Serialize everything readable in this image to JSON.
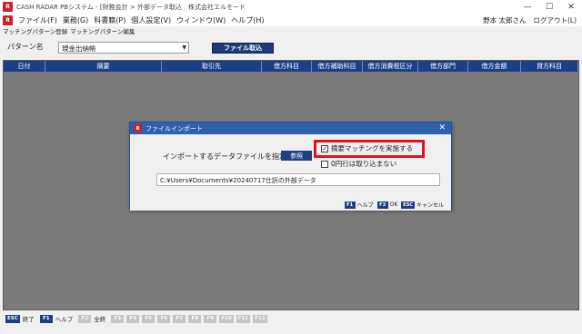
{
  "window": {
    "title": "CASH RADAR PBシステム - [財務会計 > 外部データ取込　株式会社エルモード",
    "icon_label": "R",
    "controls": [
      "—",
      "☐",
      "✕"
    ]
  },
  "menu": {
    "items": [
      "ファイル(F)",
      "業務(G)",
      "科書籍(P)",
      "個人設定(V)",
      "ウィンドウ(W)",
      "ヘルプ(H)"
    ],
    "user": "野本 太郎さん",
    "logout": "ログアウト(L)"
  },
  "subtabs": [
    "マッチングパターン登録",
    "マッチングパターン編集"
  ],
  "pattern": {
    "label": "パターン名",
    "value": "現金出納帳",
    "file_button": "ファイル取込"
  },
  "grid": {
    "columns": [
      "日付",
      "摘要",
      "取引先",
      "借方科目",
      "借方補助科目",
      "借方消費税区分",
      "借方部門",
      "借方金額",
      "貸方科目"
    ]
  },
  "status": {
    "keys": [
      {
        "key": "ESC",
        "label": "終了",
        "enabled": true
      },
      {
        "key": "F1",
        "label": "ヘルプ",
        "enabled": true
      },
      {
        "key": "F2",
        "label": "全終",
        "enabled": false
      },
      {
        "key": "F3",
        "label": "",
        "enabled": false
      },
      {
        "key": "F4",
        "label": "",
        "enabled": false
      },
      {
        "key": "F5",
        "label": "",
        "enabled": false
      },
      {
        "key": "F6",
        "label": "",
        "enabled": false
      },
      {
        "key": "F7",
        "label": "",
        "enabled": false
      },
      {
        "key": "F8",
        "label": "",
        "enabled": false
      },
      {
        "key": "F9",
        "label": "",
        "enabled": false
      },
      {
        "key": "F10",
        "label": "",
        "enabled": false
      },
      {
        "key": "F11",
        "label": "",
        "enabled": false
      },
      {
        "key": "F12",
        "label": "",
        "enabled": false
      }
    ]
  },
  "dialog": {
    "title": "ファイルインポート",
    "instruction": "インポートするデータファイルを指定",
    "browse_button": "参照",
    "checkbox_match": "摘要マッチングを実施する",
    "checkbox_match_checked": true,
    "checkbox_zero": "0円行は取り込まない",
    "checkbox_zero_checked": false,
    "file_path": "C:¥Users¥Documents¥20240717仕訳の外部データ",
    "footer": [
      {
        "key": "F1",
        "label": "ヘルプ"
      },
      {
        "key": "F3",
        "label": "OK"
      },
      {
        "key": "ESC",
        "label": "キャンセル"
      }
    ]
  }
}
